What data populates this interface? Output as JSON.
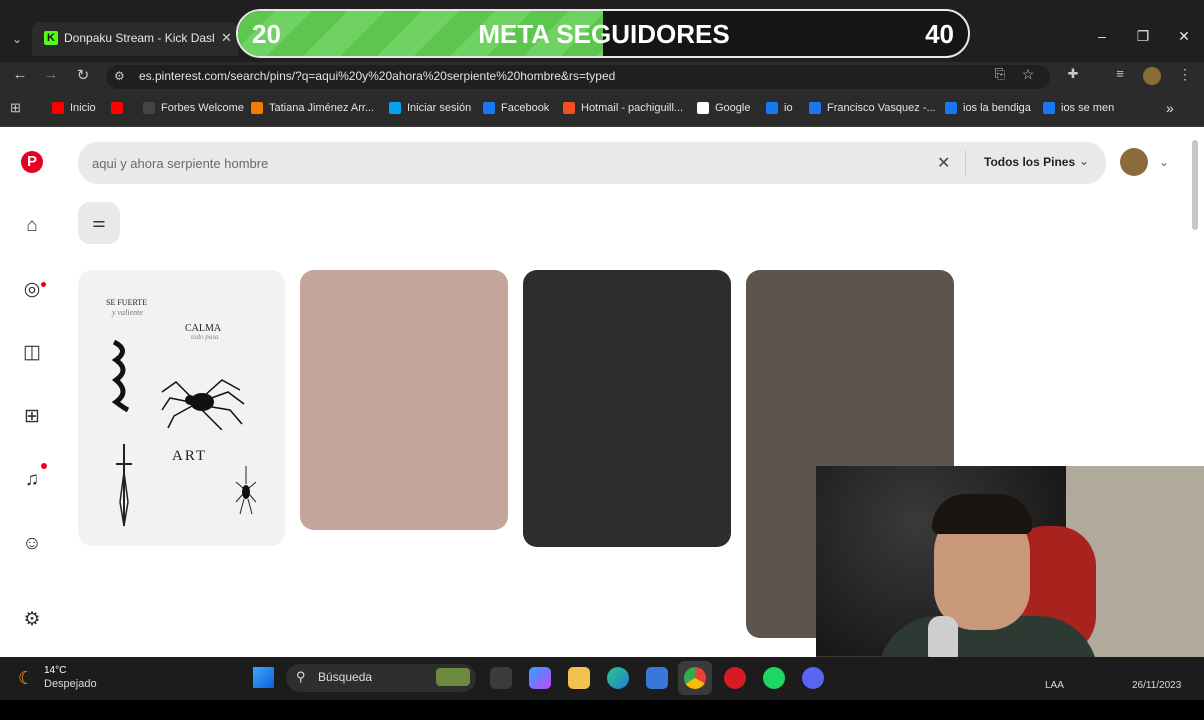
{
  "browser": {
    "tab": {
      "favicon_letter": "K",
      "title": "Donpaku Stream - Kick Dashbo",
      "close": "✕"
    },
    "tab_dropdown": "⌄",
    "window_controls": {
      "minimize": "–",
      "maximize": "❐",
      "close": "✕"
    },
    "url": "es.pinterest.com/search/pins/?q=aqui%20y%20ahora%20serpiente%20hombre&rs=typed",
    "bookmarks": [
      {
        "label": "Inicio",
        "color": "#ff0000"
      },
      {
        "label": "",
        "color": "#ff0000"
      },
      {
        "label": "Forbes Welcome",
        "color": "#444444"
      },
      {
        "label": "Tatiana Jiménez Arr...",
        "color": "#f57c00"
      },
      {
        "label": "Iniciar sesión",
        "color": "#00a4ef"
      },
      {
        "label": "Facebook",
        "color": "#1877f2"
      },
      {
        "label": "Hotmail - pachiguill...",
        "color": "#f25022"
      },
      {
        "label": "Google",
        "color": "#ffffff"
      },
      {
        "label": "io",
        "color": "#1877f2"
      },
      {
        "label": "Francisco Vasquez -...",
        "color": "#1877f2"
      },
      {
        "label": "ios la bendiga",
        "color": "#1877f2"
      },
      {
        "label": "ios se men",
        "color": "#1877f2"
      }
    ],
    "bookmarks_more": "»"
  },
  "overlay": {
    "start": "20",
    "title": "META SEGUIDORES",
    "goal": "40",
    "progress": 0.5
  },
  "pinterest": {
    "search_value": "aqui y ahora serpiente hombre",
    "filter_label": "Todos los Pines",
    "pin_colors": [
      "#f2f2f2",
      "#c4a49b",
      "#2d2d2d",
      "#5d554c"
    ],
    "art_texts": {
      "fuerte": "SE FUERTE",
      "fuerte_sub": "y valiente",
      "calma": "CALMA",
      "calma_sub": "todo pasa",
      "art": "ART"
    }
  },
  "taskbar": {
    "weather_temp": "14°C",
    "weather_desc": "Despejado",
    "search_label": "Búsqueda",
    "lang": "LAA",
    "date": "26/11/2023"
  }
}
